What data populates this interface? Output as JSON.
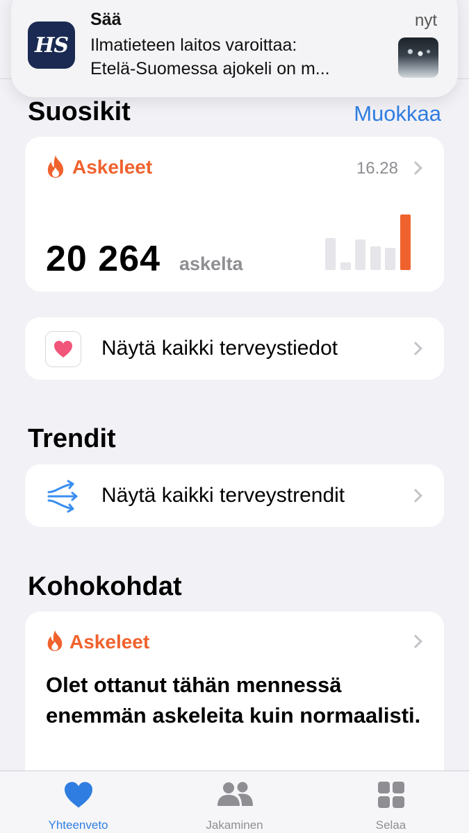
{
  "notification": {
    "app": "Sää",
    "time": "nyt",
    "icon_text": "HS",
    "line1": "Ilmatieteen laitos varoittaa:",
    "line2": "Etelä-Suomessa ajokeli on m..."
  },
  "favorites": {
    "title": "Suosikit",
    "edit": "Muokkaa",
    "steps_card": {
      "title": "Askeleet",
      "time": "16.28",
      "value": "20 264",
      "unit": "askelta",
      "accent_color": "#f0622d",
      "bars": [
        {
          "rel_value": 0.58,
          "today": false
        },
        {
          "rel_value": 0.14,
          "today": false
        },
        {
          "rel_value": 0.55,
          "today": false
        },
        {
          "rel_value": 0.42,
          "today": false
        },
        {
          "rel_value": 0.4,
          "today": false
        },
        {
          "rel_value": 1.0,
          "today": true
        }
      ]
    },
    "all_health": {
      "label": "Näytä kaikki terveystiedot",
      "icon": "heart-icon"
    }
  },
  "trends": {
    "title": "Trendit",
    "all_trends": {
      "label": "Näytä kaikki terveystrendit",
      "icon": "trends-arrows-icon"
    }
  },
  "highlights": {
    "title": "Kohokohdat",
    "card": {
      "title": "Askeleet",
      "text": "Olet ottanut tähän mennessä enemmän askeleita kuin normaalisti."
    }
  },
  "tabbar": {
    "tabs": [
      {
        "label": "Yhteenveto",
        "icon": "heart-fill-icon",
        "active": true
      },
      {
        "label": "Jakaminen",
        "icon": "people-icon",
        "active": false
      },
      {
        "label": "Selaa",
        "icon": "grid-icon",
        "active": false
      }
    ]
  },
  "colors": {
    "accent_blue": "#2f7de1",
    "steps_orange": "#f0622d",
    "background": "#f2f1f6"
  }
}
